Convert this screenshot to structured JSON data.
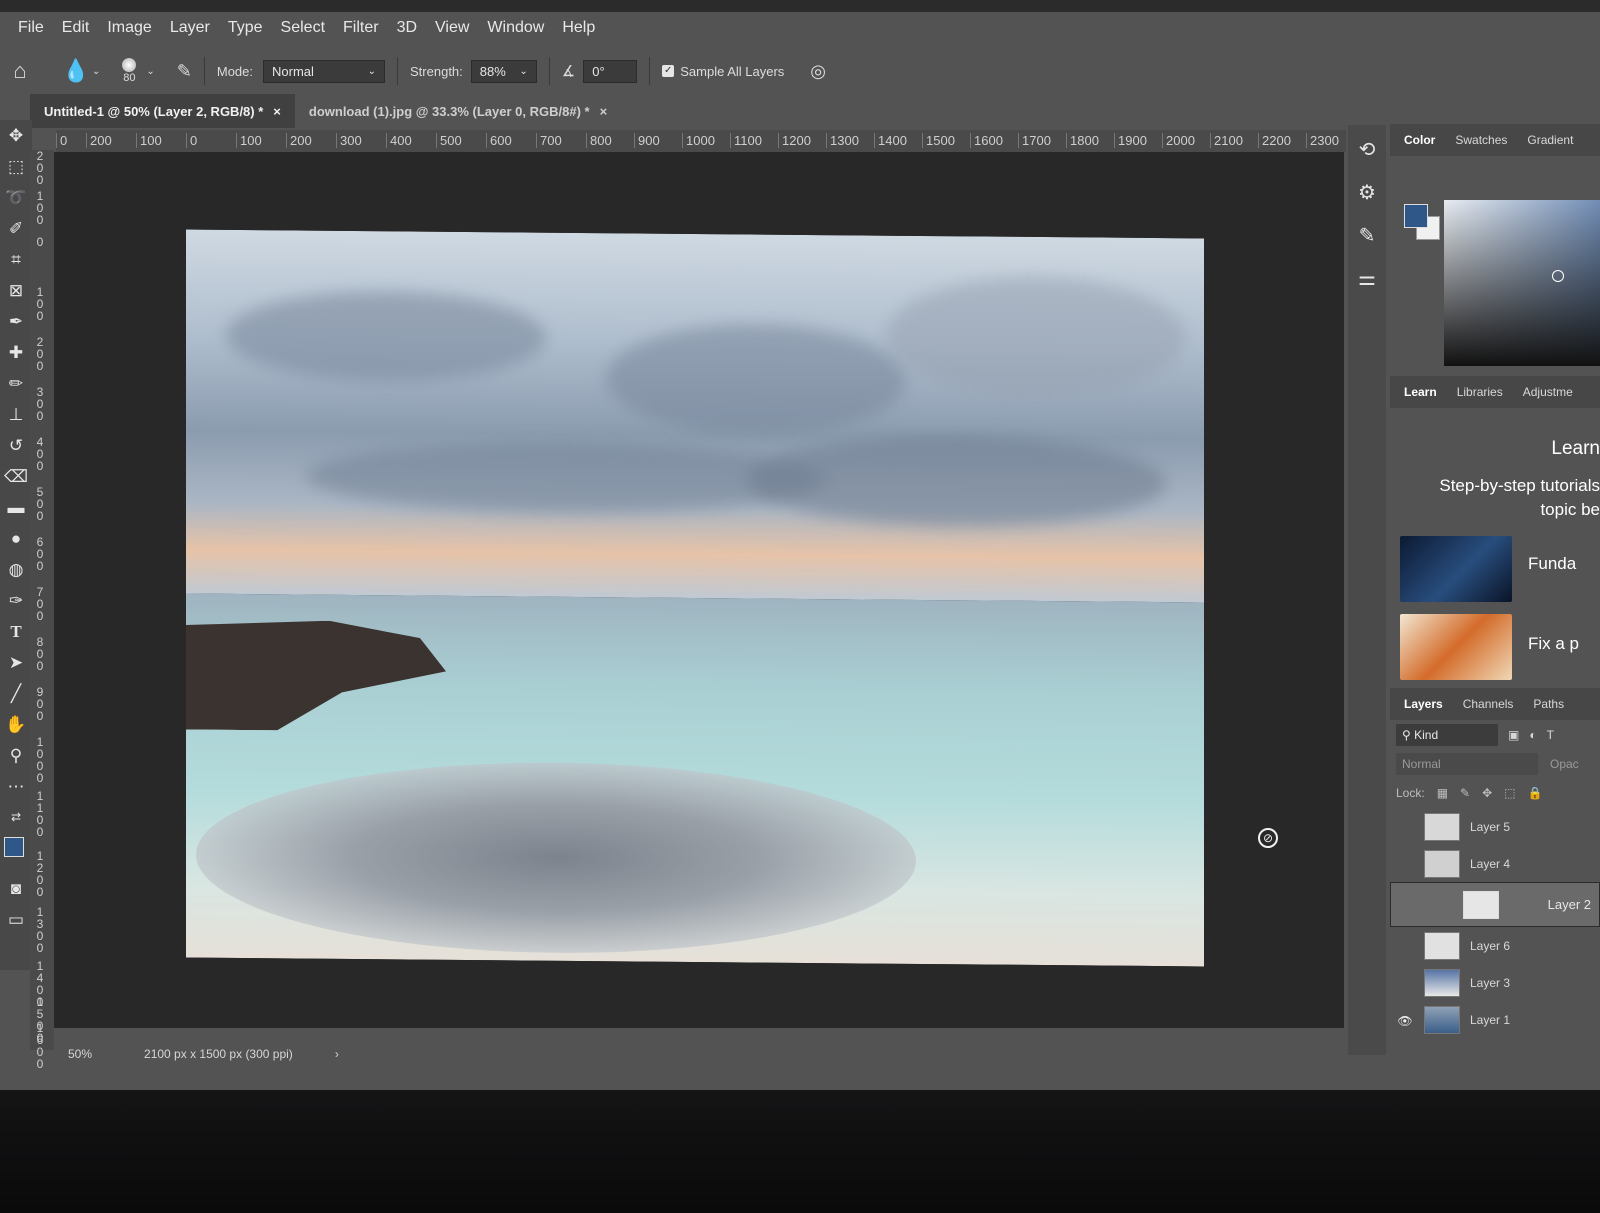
{
  "menu": [
    "File",
    "Edit",
    "Image",
    "Layer",
    "Type",
    "Select",
    "Filter",
    "3D",
    "View",
    "Window",
    "Help"
  ],
  "options": {
    "brush_size": "80",
    "mode_label": "Mode:",
    "mode_value": "Normal",
    "strength_label": "Strength:",
    "strength_value": "88%",
    "angle_value": "0°",
    "sample_all_label": "Sample All Layers"
  },
  "tabs": [
    {
      "title": "Untitled-1 @ 50% (Layer 2, RGB/8) *",
      "close": "×"
    },
    {
      "title": "download (1).jpg @ 33.3% (Layer 0, RGB/8#) *",
      "close": "×"
    }
  ],
  "hruler": [
    "0",
    "200",
    "100",
    "0",
    "100",
    "200",
    "300",
    "400",
    "500",
    "600",
    "700",
    "800",
    "900",
    "1000",
    "1100",
    "1200",
    "1300",
    "1400",
    "1500",
    "1600",
    "1700",
    "1800",
    "1900",
    "2000",
    "2100",
    "2200",
    "2300"
  ],
  "vruler": [
    "200",
    "100",
    "0",
    "100",
    "200",
    "300",
    "400",
    "500",
    "600",
    "700",
    "800",
    "900",
    "1000",
    "1100",
    "1200",
    "1300",
    "1400",
    "1500",
    "1600"
  ],
  "status": {
    "zoom": "50%",
    "doc_info": "2100 px x 1500 px (300 ppi)",
    "arrow": "›"
  },
  "panel_tabs_top": [
    "Color",
    "Swatches",
    "Gradient"
  ],
  "panel_tabs_mid": [
    "Learn",
    "Libraries",
    "Adjustme"
  ],
  "learn": {
    "title": "Learn",
    "subtitle_1": "Step-by-step tutorials",
    "subtitle_2": "topic be",
    "tutorials": [
      "Funda",
      "Fix a p"
    ]
  },
  "panel_tabs_layers": [
    "Layers",
    "Channels",
    "Paths"
  ],
  "layers_panel": {
    "kind_label": "Kind",
    "blend_mode": "Normal",
    "opacity_label": "Opac",
    "lock_label": "Lock:",
    "layers": [
      {
        "name": "Layer 5",
        "visible": false,
        "selected": false
      },
      {
        "name": "Layer 4",
        "visible": false,
        "selected": false
      },
      {
        "name": "Layer 2",
        "visible": false,
        "selected": true
      },
      {
        "name": "Layer 6",
        "visible": false,
        "selected": false
      },
      {
        "name": "Layer 3",
        "visible": false,
        "selected": false
      },
      {
        "name": "Layer 1",
        "visible": true,
        "selected": false
      }
    ]
  },
  "colors": {
    "foreground": "#2f5787",
    "background": "#f0f0f0"
  }
}
